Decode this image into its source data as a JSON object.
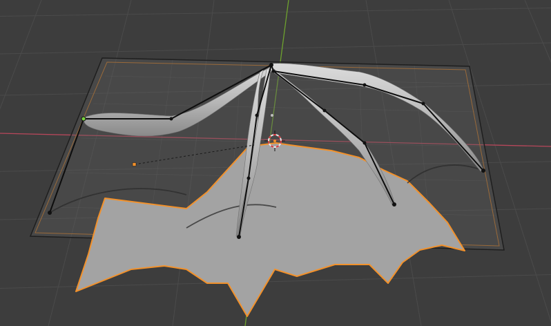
{
  "viewport": {
    "name": "3D Viewport",
    "background": "#3d3d3d",
    "grid_color": "#4a4a4a",
    "x_axis_color": "#c2475a",
    "y_axis_color": "#71a52e",
    "selection_color": "#f2912b",
    "active_object": "curve-mesh-plane",
    "tools": [
      "3d-cursor-icon",
      "origin-point-icon"
    ]
  }
}
